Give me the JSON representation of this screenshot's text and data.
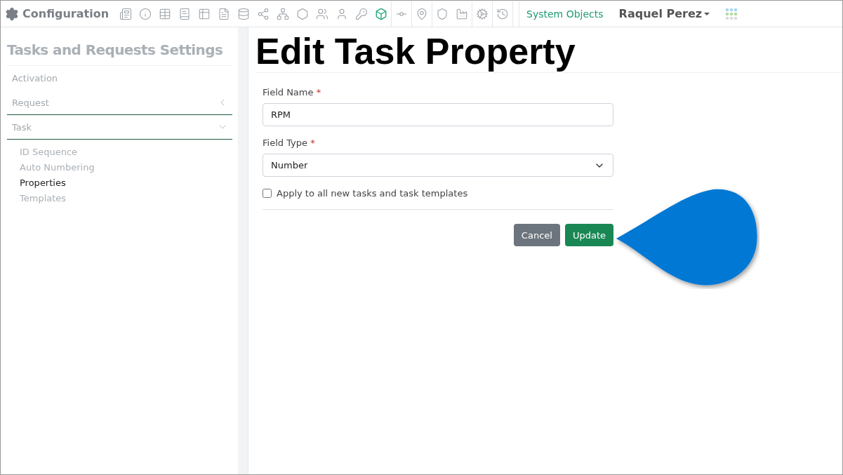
{
  "app": {
    "title": "Configuration"
  },
  "toolbar": [
    {
      "selected": false
    },
    {
      "selected": false
    },
    {
      "selected": false
    },
    {
      "selected": false
    },
    {
      "selected": false
    },
    {
      "selected": false
    },
    {
      "selected": false
    },
    {
      "selected": false
    },
    {
      "selected": false
    },
    {
      "selected": false
    },
    {
      "selected": false
    },
    {
      "selected": false
    },
    {
      "selected": false
    },
    {
      "selected": true
    },
    {
      "selected": false
    },
    {
      "selected": false
    },
    {
      "selected": false
    },
    {
      "selected": false
    },
    {
      "selected": false
    },
    {
      "selected": false
    }
  ],
  "system_objects": "System Objects",
  "user": {
    "name": "Raquel Perez"
  },
  "sidebar": {
    "title": "Tasks and Requests Settings",
    "items": [
      {
        "label": "Activation",
        "kind": "link"
      },
      {
        "label": "Request",
        "kind": "group",
        "expanded": false
      },
      {
        "label": "Task",
        "kind": "group",
        "expanded": true,
        "children": [
          {
            "label": "ID Sequence",
            "selected": false
          },
          {
            "label": "Auto Numbering",
            "selected": false
          },
          {
            "label": "Properties",
            "selected": true
          },
          {
            "label": "Templates",
            "selected": false
          }
        ]
      }
    ]
  },
  "form": {
    "title": "Edit Task Property",
    "field_name": {
      "label": "Field Name",
      "required_mark": "*",
      "value": "RPM"
    },
    "field_type": {
      "label": "Field Type",
      "required_mark": "*",
      "value": "Number"
    },
    "apply_all": {
      "label": "Apply to all new tasks and task templates",
      "checked": false
    },
    "buttons": [
      {
        "label": "Cancel",
        "kind": "secondary"
      },
      {
        "label": "Update",
        "kind": "primary"
      }
    ]
  }
}
